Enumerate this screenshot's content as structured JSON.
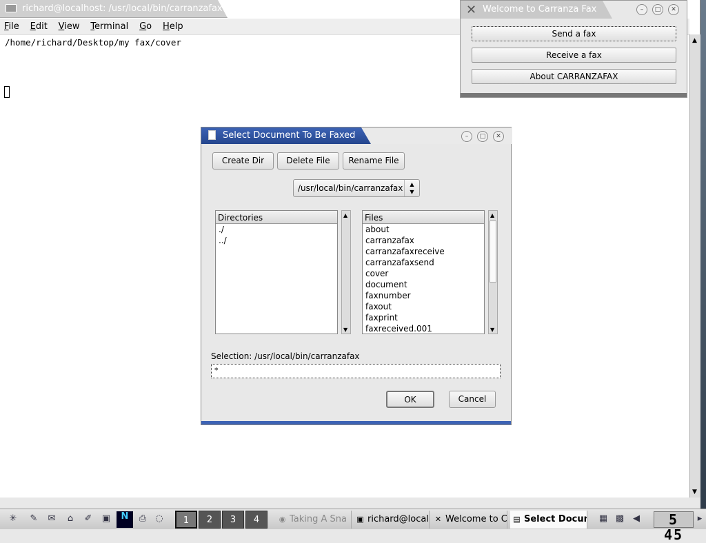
{
  "terminal": {
    "title": "richard@localhost: /usr/local/bin/carranzafax",
    "menu": [
      "File",
      "Edit",
      "View",
      "Terminal",
      "Go",
      "Help"
    ],
    "text_line": "/home/richard/Desktop/my fax/cover"
  },
  "carranza_window": {
    "title": "Welcome to Carranza Fax",
    "buttons": [
      "Send a fax",
      "Receive a fax",
      "About CARRANZAFAX"
    ]
  },
  "dialog": {
    "title": "Select Document To Be Faxed",
    "buttons": {
      "create_dir": "Create Dir",
      "delete_file": "Delete File",
      "rename_file": "Rename File"
    },
    "path_combo": "/usr/local/bin/carranzafax",
    "directories_header": "Directories",
    "directories": [
      "./",
      "../"
    ],
    "files_header": "Files",
    "files": [
      "about",
      "carranzafax",
      "carranzafaxreceive",
      "carranzafaxsend",
      "cover",
      "document",
      "faxnumber",
      "faxout",
      "faxprint",
      "faxreceived.001"
    ],
    "selection_label": "Selection: /usr/local/bin/carranzafax",
    "selection_value": "*",
    "ok_label": "OK",
    "cancel_label": "Cancel"
  },
  "taskbar": {
    "workspaces": [
      "1",
      "2",
      "3",
      "4"
    ],
    "tasks": [
      "Taking A Sna",
      "richard@local",
      "Welcome to C",
      "Select Docum"
    ],
    "clock": "5 45"
  }
}
